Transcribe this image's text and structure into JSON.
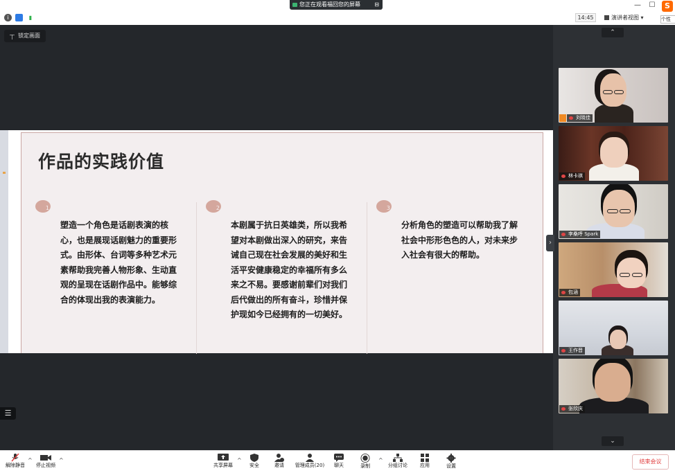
{
  "window": {
    "share_banner": "您正在观看福回您的屏幕",
    "share_banner_more": "⊟",
    "minimize": "—",
    "maximize": "☐",
    "close": "✕",
    "time": "14:45",
    "view_mode": "演讲者视图",
    "logo_letter": "S",
    "logo_tooltip": "个性"
  },
  "stage": {
    "pin_label": "锁定画面"
  },
  "slide": {
    "title": "作品的实践价值",
    "columns": [
      {
        "num": "1",
        "text": "塑造一个角色是话剧表演的核心，也是展现话剧魅力的重要形式。由形体、台词等多种艺术元素帮助我完善人物形象、生动直观的呈现在话剧作品中。能够综合的体现出我的表演能力。"
      },
      {
        "num": "2",
        "text": "本剧属于抗日英雄类，所以我希望对本剧做出深入的研究，来告诫自己现在社会发展的美好和生活平安健康稳定的幸福所有多么来之不易。要感谢前辈们对我们后代做出的所有奋斗，珍惜并保护现如今已经拥有的一切美好。"
      },
      {
        "num": "3",
        "text": "分析角色的塑造可以帮助我了解社会中形形色色的人，对未来步入社会有很大的帮助。"
      }
    ]
  },
  "gallery": {
    "up_arrow": "⌃",
    "down_arrow": "⌄",
    "collapse": "›",
    "participants": [
      {
        "name": "刘晓佳"
      },
      {
        "name": "林卡祺"
      },
      {
        "name": "李桑呼 Spark"
      },
      {
        "name": "包涵"
      },
      {
        "name": "王作晋"
      },
      {
        "name": "张欣庆"
      }
    ]
  },
  "toolbar": {
    "unmute": "解除静音",
    "stop_video": "停止视频",
    "share_screen": "共享屏幕",
    "security": "安全",
    "invite": "邀请",
    "participants": "管理成员(20)",
    "chat": "聊天",
    "record": "录制",
    "breakout": "分组讨论",
    "apps": "应用",
    "settings": "设置",
    "end_meeting": "结束会议"
  },
  "colors": {
    "stage_bg": "#24272b",
    "gallery_bg": "#2d3034",
    "slide_bg": "#f3eeef",
    "badge": "#d4a79d",
    "end_red": "#e03c3c"
  }
}
